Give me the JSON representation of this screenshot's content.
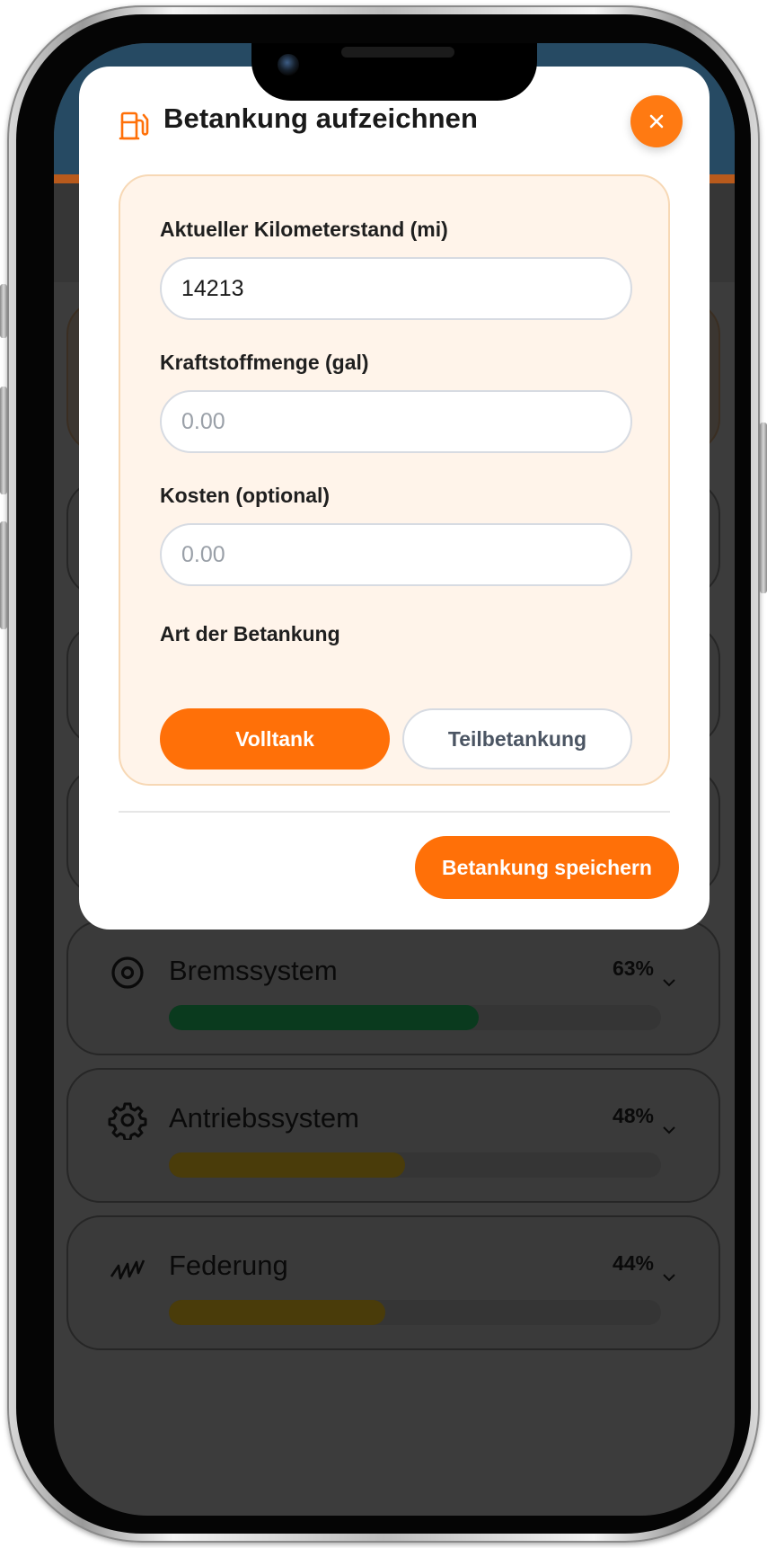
{
  "modal": {
    "title": "Betankung aufzeichnen",
    "fields": {
      "odometer": {
        "label": "Aktueller Kilometerstand (mi)",
        "value": "14213",
        "placeholder": ""
      },
      "fuel": {
        "label": "Kraftstoffmenge (gal)",
        "value": "",
        "placeholder": "0.00"
      },
      "cost": {
        "label": "Kosten (optional)",
        "value": "",
        "placeholder": "0.00"
      }
    },
    "refuel_type": {
      "label": "Art der Betankung",
      "options": [
        "Volltank",
        "Teilbetankung"
      ],
      "selected": "Volltank"
    },
    "save_label": "Betankung speichern"
  },
  "systems": [
    {
      "name": "Bremssystem",
      "percent_label": "63%",
      "percent": 63,
      "icon": "target-icon",
      "color": "#0a3a1e"
    },
    {
      "name": "Antriebssystem",
      "percent_label": "48%",
      "percent": 48,
      "icon": "gear-icon",
      "color": "#4a3c0a"
    },
    {
      "name": "Federung",
      "percent_label": "44%",
      "percent": 44,
      "icon": "spring-icon",
      "color": "#4a3c0a"
    }
  ],
  "colors": {
    "accent": "#ff7008",
    "panel_background": "#fff4ea",
    "overlay": "#3c3c3c"
  }
}
